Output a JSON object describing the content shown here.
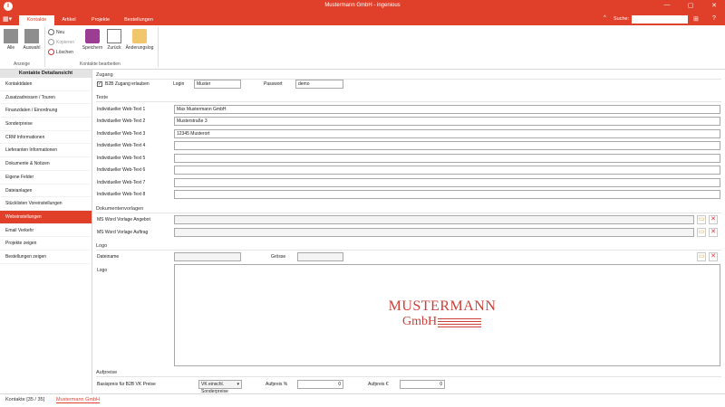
{
  "window": {
    "title": "Mustermann GmbH - ingenious"
  },
  "ribbon": {
    "tabs": [
      "Kontakte",
      "Artikel",
      "Projekte",
      "Bestellungen"
    ],
    "search_label": "Suche:",
    "alle": "Alle",
    "auswahl": "Auswahl",
    "neu": "Neu",
    "kopieren": "Kopieren",
    "loeschen": "Löschen",
    "speichern": "Speichern",
    "zurueck": "Zurück",
    "aenderungslog": "Änderungslog",
    "group_anzeige": "Anzeige",
    "group_bearbeiten": "Kontakte bearbeiten"
  },
  "sidebar": {
    "header": "Kontakte Detailansicht",
    "items": [
      "Kontaktdaten",
      "Zusatzadressen / Touren",
      "Finanzdaten / Einordnung",
      "Sonderpreise",
      "CRM Informationen",
      "Lieferanten Informationen",
      "Dokumente & Notizen",
      "Eigene Felder",
      "Dateianlagen",
      "Stücklisten Voreinstellungen",
      "Webeinstellungen",
      "Email Verkehr",
      "Projekte zeigen",
      "Bestellungen zeigen"
    ]
  },
  "zugang": {
    "title": "Zugang",
    "b2b_label": "B2B Zugang erlauben",
    "login_label": "Login",
    "login_value": "Muster",
    "passwort_label": "Passwort",
    "passwort_value": "demo"
  },
  "texte": {
    "title": "Texte",
    "rows": [
      {
        "label": "Individueller Web-Text 1",
        "value": "Max Mustermann GmbH"
      },
      {
        "label": "Individueller Web-Text 2",
        "value": "Musterstraße 3"
      },
      {
        "label": "Individueller Web-Text 3",
        "value": "12345 Musterort"
      },
      {
        "label": "Individueller Web-Text 4",
        "value": ""
      },
      {
        "label": "Individueller Web-Text 5",
        "value": ""
      },
      {
        "label": "Individueller Web-Text 6",
        "value": ""
      },
      {
        "label": "Individueller Web-Text 7",
        "value": ""
      },
      {
        "label": "Individueller Web-Text 8",
        "value": ""
      }
    ]
  },
  "dokumente": {
    "title": "Dokumentenvorlagen",
    "angebot_label": "MS Word Vorlage Angebot",
    "auftrag_label": "MS Word Vorlage Auftrag"
  },
  "logo": {
    "title": "Logo",
    "dateiname_label": "Dateiname",
    "groesse_label": "Grösse",
    "logo_label": "Logo",
    "brand_line1": "MUSTERMANN",
    "brand_line2": "GmbH"
  },
  "aufpreise": {
    "title": "Aufpreise",
    "basispreis_label": "Basispreis für B2B VK Preise",
    "basispreis_value": "VK einschl. Sonderpreise",
    "prozent_label": "Aufpreis %",
    "prozent_value": "0",
    "euro_label": "Aufpreis €",
    "euro_value": "0"
  },
  "status": {
    "tab1": "Kontakte [35 / 35]",
    "tab2": "Mustermann GmbH"
  }
}
